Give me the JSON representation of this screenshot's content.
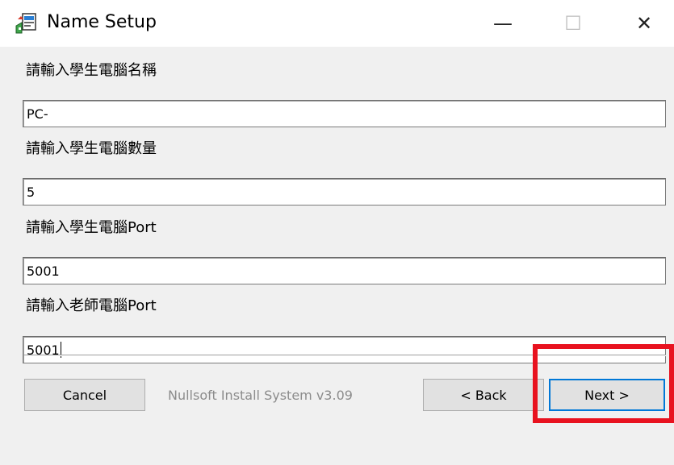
{
  "window": {
    "title": "Name Setup",
    "minimize_glyph": "—",
    "maximize_glyph": "☐",
    "close_glyph": "✕"
  },
  "form": {
    "fields": [
      {
        "label": "請輸入學生電腦名稱",
        "value": "PC-"
      },
      {
        "label": "請輸入學生電腦數量",
        "value": "5"
      },
      {
        "label": "請輸入學生電腦Port",
        "value": "5001"
      },
      {
        "label": "請輸入老師電腦Port",
        "value": "5001"
      }
    ]
  },
  "footer": {
    "branding": "Nullsoft Install System v3.09",
    "cancel_label": "Cancel",
    "back_label": "< Back",
    "next_label": "Next >"
  },
  "colors": {
    "highlight": "#e8121f",
    "focus_border": "#0078d7"
  }
}
